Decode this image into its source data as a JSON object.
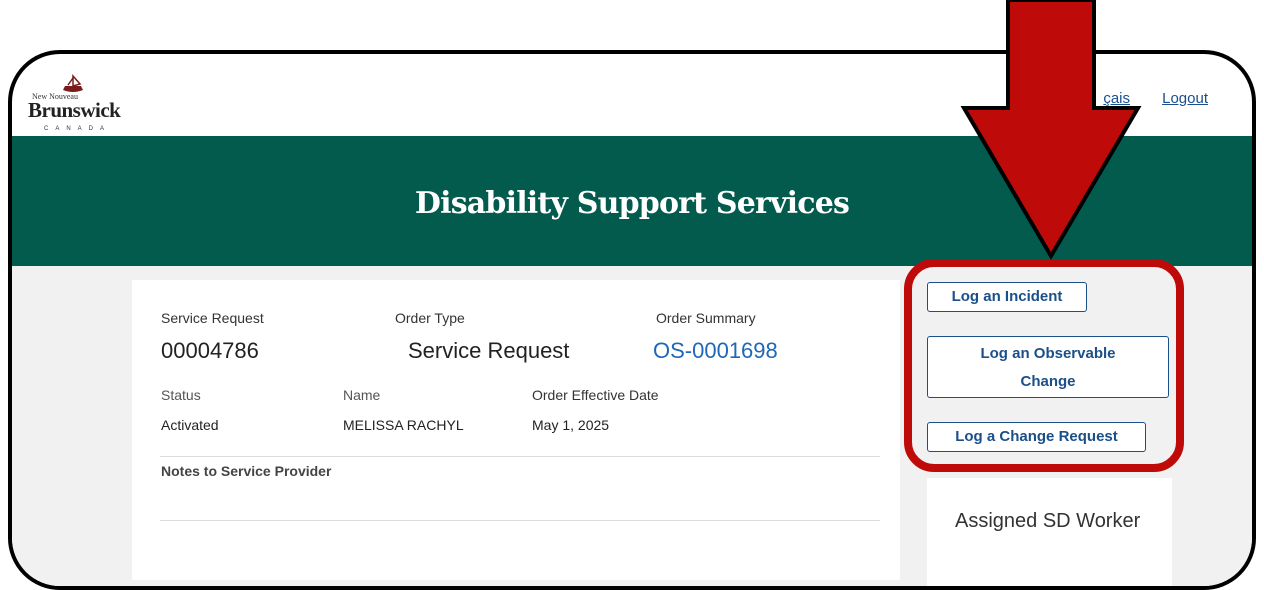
{
  "header": {
    "logo": {
      "top_text": "New  Nouveau",
      "name": "Brunswick",
      "country": "CANADA"
    },
    "lang_link": "çais",
    "logout_link": "Logout"
  },
  "banner": {
    "title": "Disability Support Services"
  },
  "service": {
    "request_label": "Service Request",
    "request_number": "00004786",
    "order_type_label": "Order Type",
    "order_type": "Service Request",
    "order_summary_label": "Order Summary",
    "order_summary": "OS-0001698",
    "status_label": "Status",
    "status": "Activated",
    "name_label": "Name",
    "name": "MELISSA RACHYL",
    "effective_label": "Order Effective Date",
    "effective_date": "May 1, 2025",
    "notes_label": "Notes to Service Provider"
  },
  "actions": {
    "incident": "Log an Incident",
    "observable_line1": "Log an Observable",
    "observable_line2": "Change",
    "change_request": "Log a Change Request"
  },
  "assigned": {
    "title": "Assigned SD Worker"
  },
  "colors": {
    "banner": "#035b4e",
    "link": "#1f67b8",
    "button": "#1b4f8a",
    "highlight": "#bf0a0a"
  },
  "icons": [
    "arrow-down-icon"
  ]
}
